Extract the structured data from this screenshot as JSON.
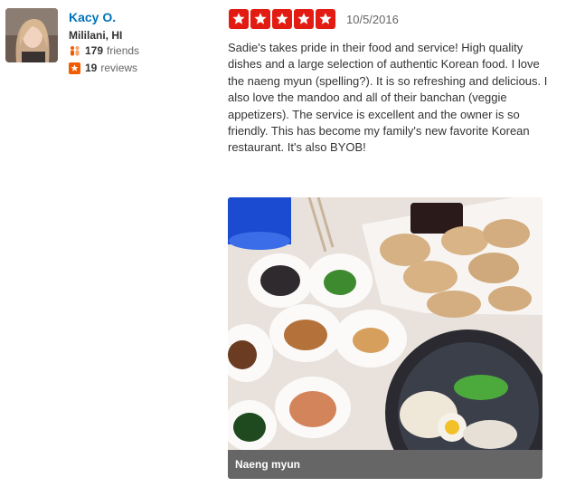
{
  "reviewer": {
    "name": "Kacy O.",
    "location": "Mililani, HI",
    "friends_count": "179",
    "friends_label": "friends",
    "reviews_count": "19",
    "reviews_label": "reviews"
  },
  "review": {
    "rating": 5,
    "max_rating": 5,
    "date": "10/5/2016",
    "text": "Sadie's takes pride in their food and service! High quality dishes and a large selection of authentic Korean food. I love the naeng myun (spelling?). It is so refreshing and delicious. I also love the mandoo and all of their banchan (veggie appetizers). The service is excellent and the owner is so friendly. This has become my family's new favorite Korean restaurant. It's also BYOB!"
  },
  "photo": {
    "caption": "Naeng myun"
  },
  "colors": {
    "star": "#e21c12",
    "link": "#0073bb",
    "caption_bg": "#666666",
    "friends_icon": "#f15c00",
    "reviews_icon": "#f15c00"
  },
  "icons": {
    "friends": "friends-icon",
    "reviews": "reviews-star-icon",
    "rating_star": "star-icon"
  }
}
